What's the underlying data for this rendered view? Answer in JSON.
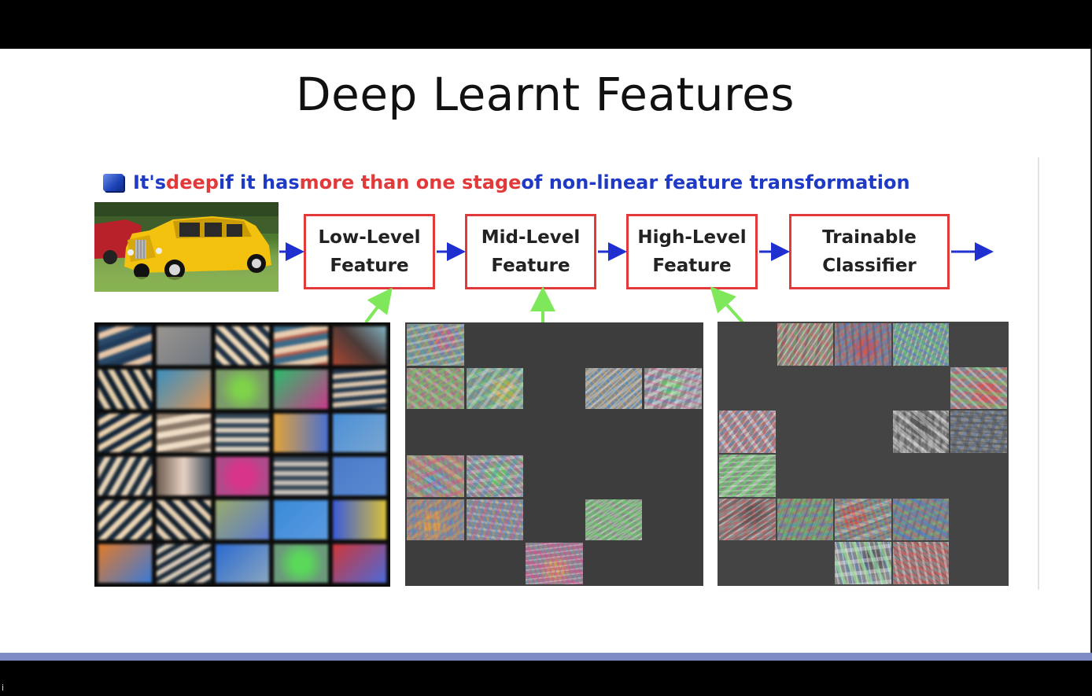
{
  "slide": {
    "title": "Deep Learnt Features",
    "corner_mark": "i"
  },
  "headline": {
    "part1": "It's ",
    "part2": "deep",
    "part3": " if it has ",
    "part4": "more than one stage",
    "part5": " of non-linear feature transformation"
  },
  "pipeline": {
    "input_image": "car-photo",
    "stages": [
      {
        "line1": "Low-Level",
        "line2": "Feature"
      },
      {
        "line1": "Mid-Level",
        "line2": "Feature"
      },
      {
        "line1": "High-Level",
        "line2": "Feature"
      },
      {
        "line1": "Trainable",
        "line2": "Classifier"
      }
    ]
  },
  "feature_grids": [
    {
      "name": "low-level-filters",
      "rows": 6,
      "cols": 5
    },
    {
      "name": "mid-level-filters",
      "rows": 6,
      "cols": 5
    },
    {
      "name": "high-level-filters",
      "rows": 6,
      "cols": 5
    }
  ],
  "colors": {
    "accent_bar": "#7f8bc4",
    "box_border": "#e23a3a",
    "flow_arrow": "#1f2fd0",
    "connector": "#7ee85a",
    "text_blue": "#1f3bc6",
    "text_red": "#e23a3a"
  }
}
